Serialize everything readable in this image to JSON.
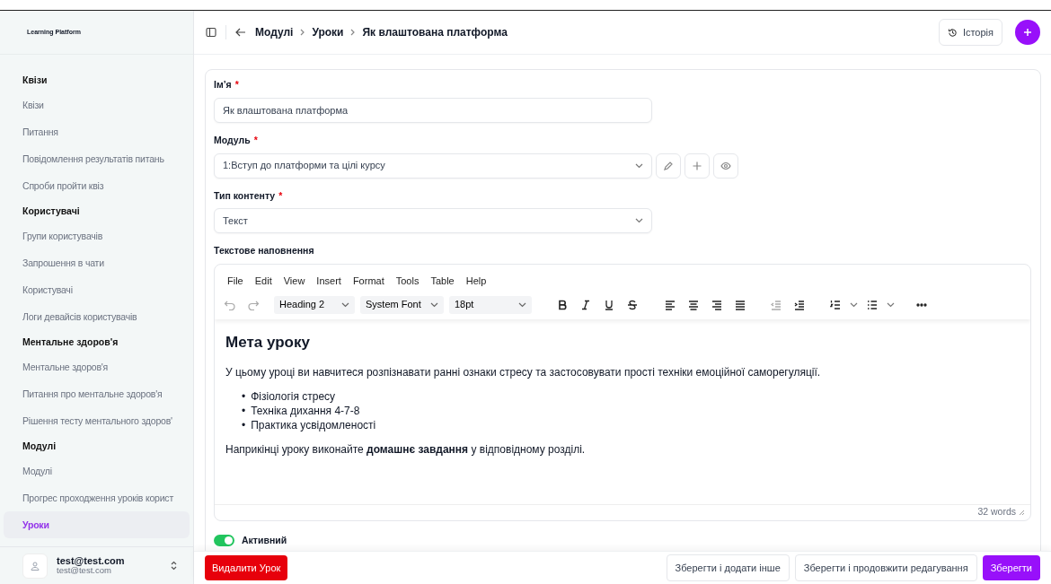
{
  "sidebar": {
    "logo_text": "Learning Platform",
    "groups": [
      {
        "title": "Квізи",
        "items": [
          {
            "label": "Квізи",
            "selected": false
          },
          {
            "label": "Питання",
            "selected": false
          },
          {
            "label": "Повідомлення результатів питань",
            "selected": false
          },
          {
            "label": "Спроби пройти квіз",
            "selected": false
          }
        ]
      },
      {
        "title": "Користувачі",
        "items": [
          {
            "label": "Групи користувачів",
            "selected": false
          },
          {
            "label": "Запрошення в чати",
            "selected": false
          },
          {
            "label": "Користувачі",
            "selected": false
          },
          {
            "label": "Логи девайсів користувачів",
            "selected": false
          }
        ]
      },
      {
        "title": "Ментальне здоров'я",
        "items": [
          {
            "label": "Ментальне здоров'я",
            "selected": false
          },
          {
            "label": "Питання про ментальне здоров'я",
            "selected": false
          },
          {
            "label": "Рішення тесту ментального здоров'",
            "selected": false
          }
        ]
      },
      {
        "title": "Модулі",
        "items": [
          {
            "label": "Модулі",
            "selected": false
          },
          {
            "label": "Прогрес проходження уроків корист",
            "selected": false
          },
          {
            "label": "Уроки",
            "selected": true
          }
        ]
      }
    ],
    "user": {
      "email": "test@test.com",
      "subtitle": "test@test.com"
    }
  },
  "header": {
    "breadcrumbs": [
      "Модулі",
      "Уроки",
      "Як влаштована платформа"
    ],
    "history_button": "Історія"
  },
  "form": {
    "fields": [
      {
        "kind": "text",
        "label": "Ім’я",
        "required_mark": "*",
        "value": "Як влаштована платформа"
      },
      {
        "kind": "select-actions",
        "label": "Модуль",
        "required_mark": "*",
        "value": "1:Вступ до платформи та цілі курсу"
      },
      {
        "kind": "select",
        "label": "Тип контенту",
        "required_mark": "*",
        "value": "Текст"
      }
    ],
    "editor": {
      "label": "Текстове наповнення",
      "menu": [
        "File",
        "Edit",
        "View",
        "Insert",
        "Format",
        "Tools",
        "Table",
        "Help"
      ],
      "block_format": "Heading 2",
      "font": "System Font",
      "size": "18pt",
      "heading": "Мета уроку",
      "intro": "У цьому уроці ви навчитеся розпізнавати ранні ознаки стресу та застосовувати прості техніки емоційної саморегуляції.",
      "bullets": [
        {
          "marker": "•",
          "text": "Фізіологія стресу"
        },
        {
          "marker": "•",
          "text": "Техніка дихання 4-7-8"
        },
        {
          "marker": "•",
          "text": "Практика усвідомленості"
        }
      ],
      "closing": "Наприкінці уроку виконайте **домашнє завдання** у відповідному розділі.",
      "word_count": "32 words"
    },
    "active": {
      "label": "Активний",
      "on": true
    }
  },
  "footer": {
    "delete_button": "Видалити Урок",
    "buttons": [
      {
        "label": "Зберегти і додати інше",
        "kind": "secondary"
      },
      {
        "label": "Зберегти і продовжити редагування",
        "kind": "secondary"
      },
      {
        "label": "Зберегти",
        "kind": "primary"
      }
    ]
  }
}
